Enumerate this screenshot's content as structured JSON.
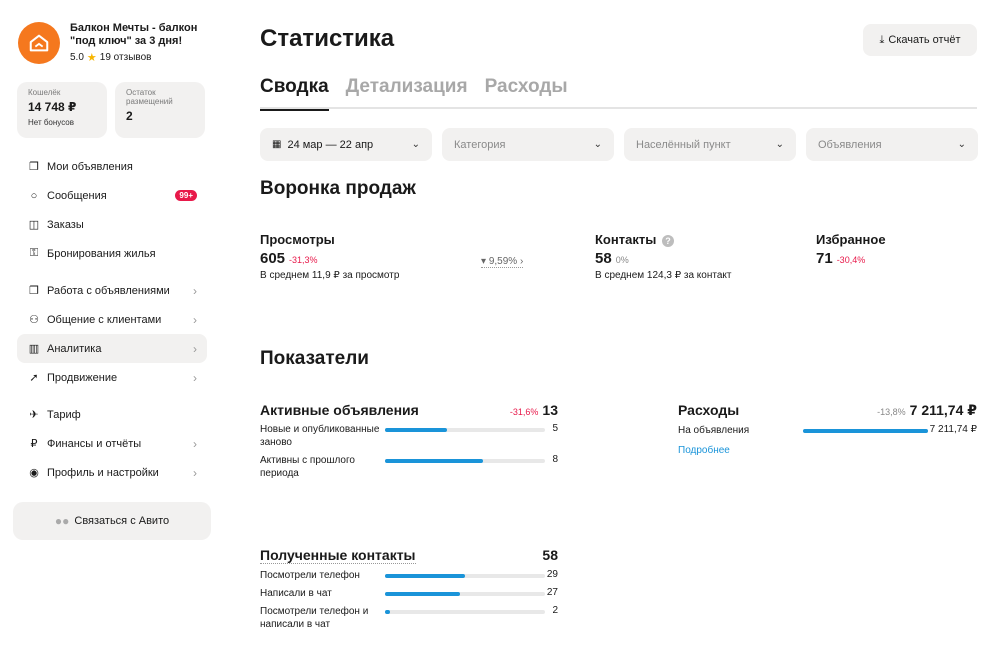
{
  "profile": {
    "name": "Балкон Мечты - балкон \"под ключ\" за 3 дня!",
    "rating": "5.0",
    "reviews": "19 отзывов"
  },
  "wallet": {
    "label": "Кошелёк",
    "value": "14 748 ₽",
    "sub": "Нет бонусов"
  },
  "placements": {
    "label": "Остаток размещений",
    "value": "2"
  },
  "menu": [
    {
      "label": "Мои объявления",
      "icon": "ads-icon"
    },
    {
      "label": "Сообщения",
      "icon": "chat-icon",
      "badge": "99+"
    },
    {
      "label": "Заказы",
      "icon": "box-icon"
    },
    {
      "label": "Бронирования жилья",
      "icon": "key-icon"
    },
    {
      "label": "Работа с объявлениями",
      "icon": "ads-work-icon"
    },
    {
      "label": "Общение с клиентами",
      "icon": "people-icon"
    },
    {
      "label": "Аналитика",
      "icon": "chart-icon"
    },
    {
      "label": "Продвижение",
      "icon": "rocket-icon"
    },
    {
      "label": "Тариф",
      "icon": "tariff-icon"
    },
    {
      "label": "Финансы и отчёты",
      "icon": "ruble-icon"
    },
    {
      "label": "Профиль и настройки",
      "icon": "profile-icon"
    }
  ],
  "contact_button": "Связаться с Авито",
  "page_title": "Статистика",
  "download_button": "Скачать отчёт",
  "tabs": [
    "Сводка",
    "Детализация",
    "Расходы"
  ],
  "filters": {
    "date": "24 мар — 22 апр",
    "category": "Категория",
    "location": "Населённый пункт",
    "ads": "Объявления"
  },
  "funnel": {
    "title": "Воронка продаж",
    "views": {
      "title": "Просмотры",
      "value": "605",
      "delta": "-31,3%",
      "sub": "В среднем 11,9 ₽ за просмотр"
    },
    "conversion": "9,59%",
    "contacts": {
      "title": "Контакты",
      "value": "58",
      "delta": "0%",
      "sub": "В среднем 124,3 ₽ за контакт"
    },
    "favorites": {
      "title": "Избранное",
      "value": "71",
      "delta": "-30,4%"
    }
  },
  "indicators": {
    "title": "Показатели",
    "active": {
      "title": "Активные объявления",
      "delta": "-31,6%",
      "total": "13",
      "rows": [
        {
          "label": "Новые и опубликованные заново",
          "value": "5",
          "fill": 0.385
        },
        {
          "label": "Активны с прошлого периода",
          "value": "8",
          "fill": 0.615
        }
      ]
    },
    "expenses": {
      "title": "Расходы",
      "delta": "-13,8%",
      "total": "7 211,74 ₽",
      "rows": [
        {
          "label": "На объявления",
          "value": "7 211,74 ₽",
          "fill": 1.0
        }
      ],
      "more": "Подробнее"
    },
    "contacts": {
      "title": "Полученные контакты",
      "total": "58",
      "rows": [
        {
          "label": "Посмотрели телефон",
          "value": "29",
          "fill": 0.5
        },
        {
          "label": "Написали в чат",
          "value": "27",
          "fill": 0.466
        },
        {
          "label": "Посмотрели телефон и написали в чат",
          "value": "2",
          "fill": 0.034
        }
      ]
    }
  },
  "colors": {
    "accent": "#1a94d9",
    "negative": "#e8194a",
    "avatar": "#f5781e"
  }
}
